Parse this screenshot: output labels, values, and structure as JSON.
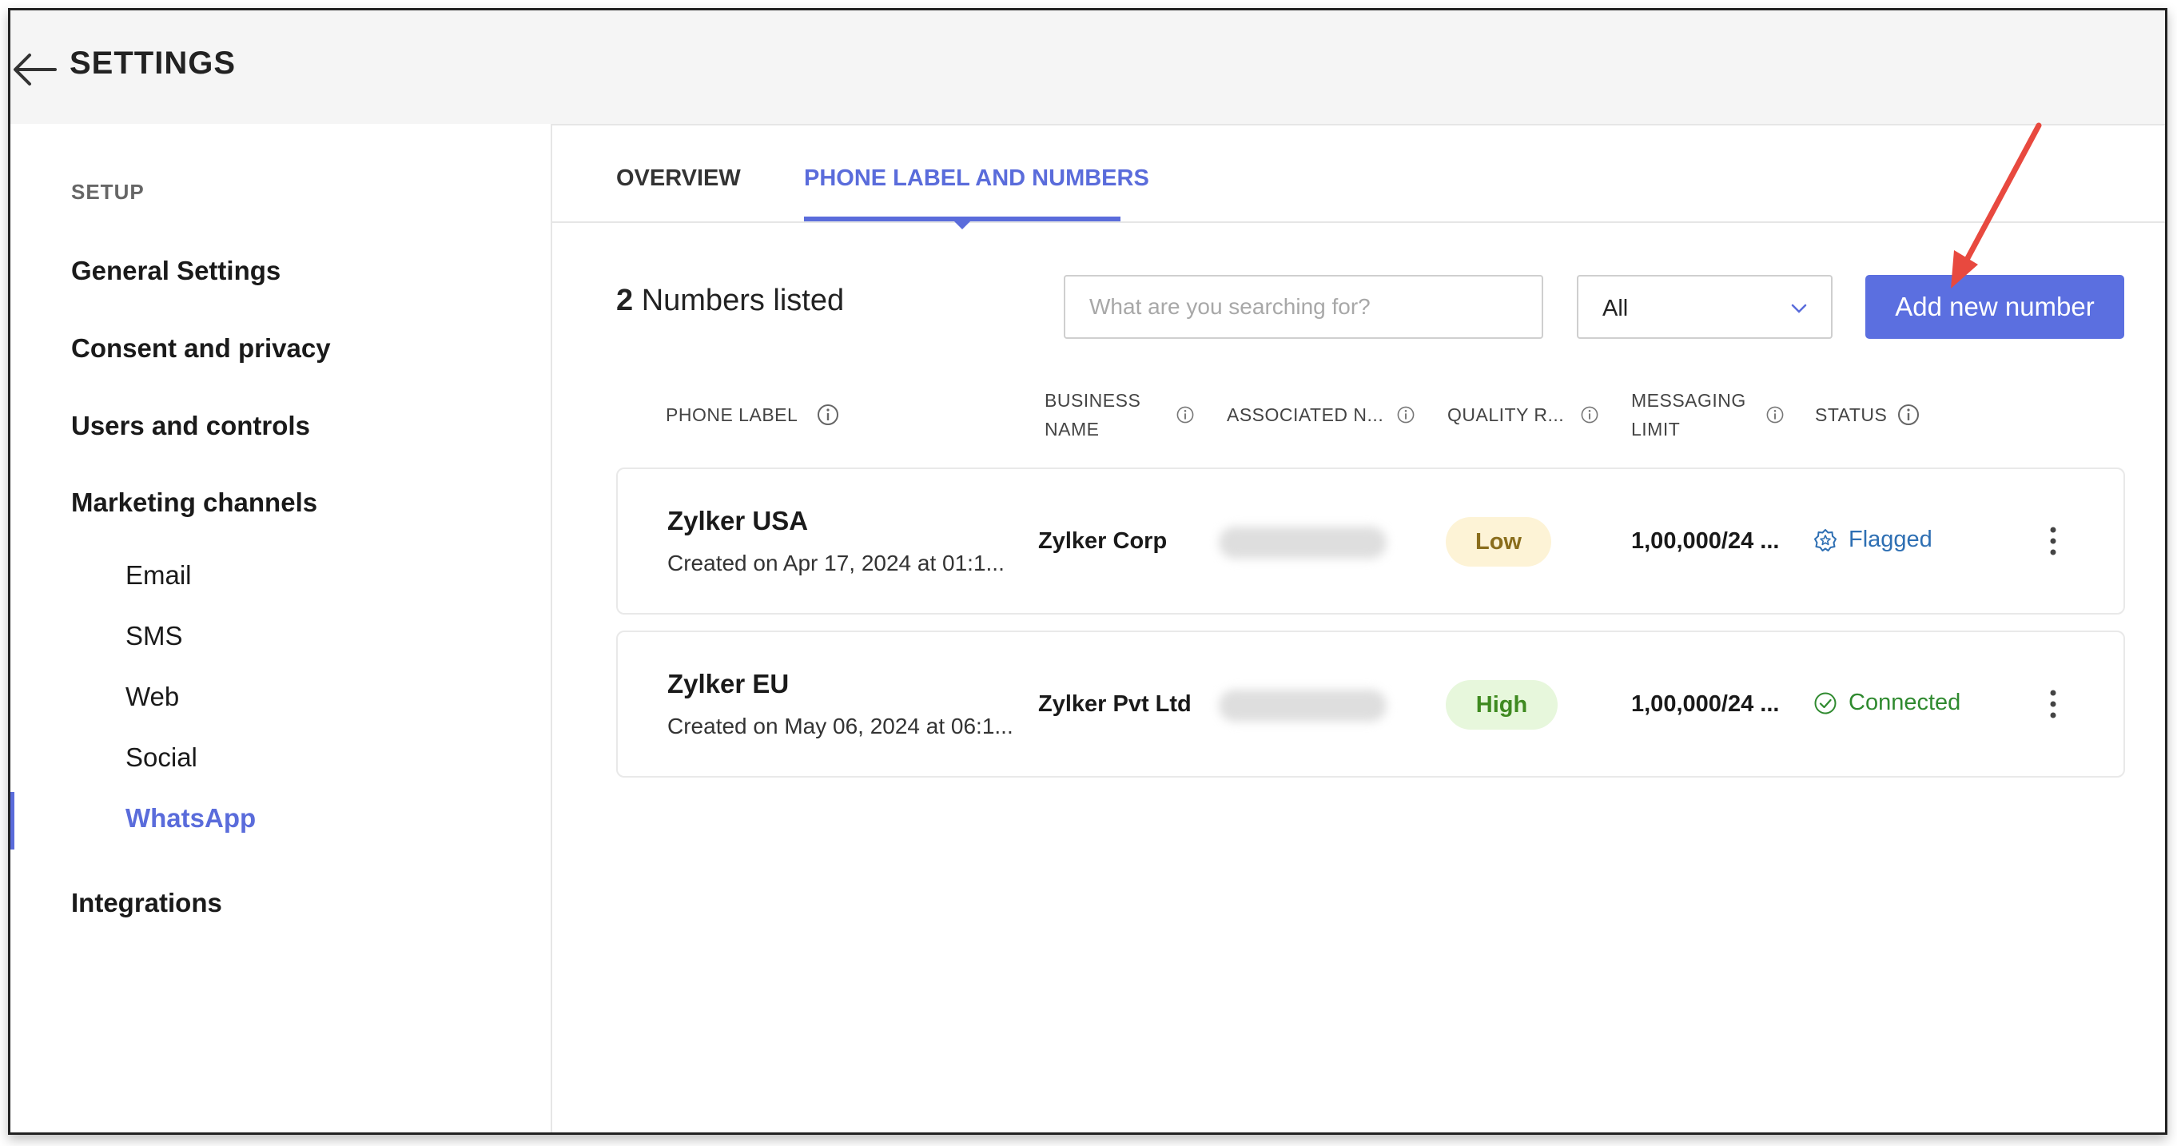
{
  "header": {
    "title": "SETTINGS"
  },
  "sidebar": {
    "section": "SETUP",
    "items": [
      {
        "label": "General Settings"
      },
      {
        "label": "Consent and privacy"
      },
      {
        "label": "Users and controls"
      },
      {
        "label": "Marketing channels"
      }
    ],
    "sub_items": [
      {
        "label": "Email"
      },
      {
        "label": "SMS"
      },
      {
        "label": "Web"
      },
      {
        "label": "Social"
      },
      {
        "label": "WhatsApp"
      }
    ],
    "footer_item": "Integrations"
  },
  "tabs": [
    {
      "label": "OVERVIEW"
    },
    {
      "label": "PHONE LABEL AND NUMBERS"
    }
  ],
  "toolbar": {
    "count": "2",
    "count_label": "Numbers listed",
    "search_placeholder": "What are you searching for?",
    "filter_value": "All",
    "add_label": "Add new number"
  },
  "columns": {
    "phone_label": "PHONE LABEL",
    "business_line1": "BUSINESS",
    "business_line2": "NAME",
    "associated": "ASSOCIATED N...",
    "quality": "QUALITY R...",
    "messaging_line1": "MESSAGING",
    "messaging_line2": "LIMIT",
    "status": "STATUS"
  },
  "rows": [
    {
      "title": "Zylker USA",
      "created": "Created on Apr 17, 2024 at 01:1...",
      "business": "Zylker Corp",
      "quality": "Low",
      "limit": "1,00,000/24 ...",
      "status": "Flagged"
    },
    {
      "title": "Zylker EU",
      "created": "Created on May 06, 2024 at 06:1...",
      "business": "Zylker Pvt Ltd",
      "quality": "High",
      "limit": "1,00,000/24 ...",
      "status": "Connected"
    }
  ],
  "colors": {
    "accent": "#5a6cdb",
    "flagged": "#2e6fb3",
    "connected": "#2f8a2f",
    "annotation": "#e8493f"
  },
  "icons": {
    "back": "arrow-left-icon",
    "info": "info-icon",
    "chevron": "chevron-down-icon",
    "flag": "badge-alert-icon",
    "connected": "check-circle-icon",
    "more": "kebab-icon"
  }
}
